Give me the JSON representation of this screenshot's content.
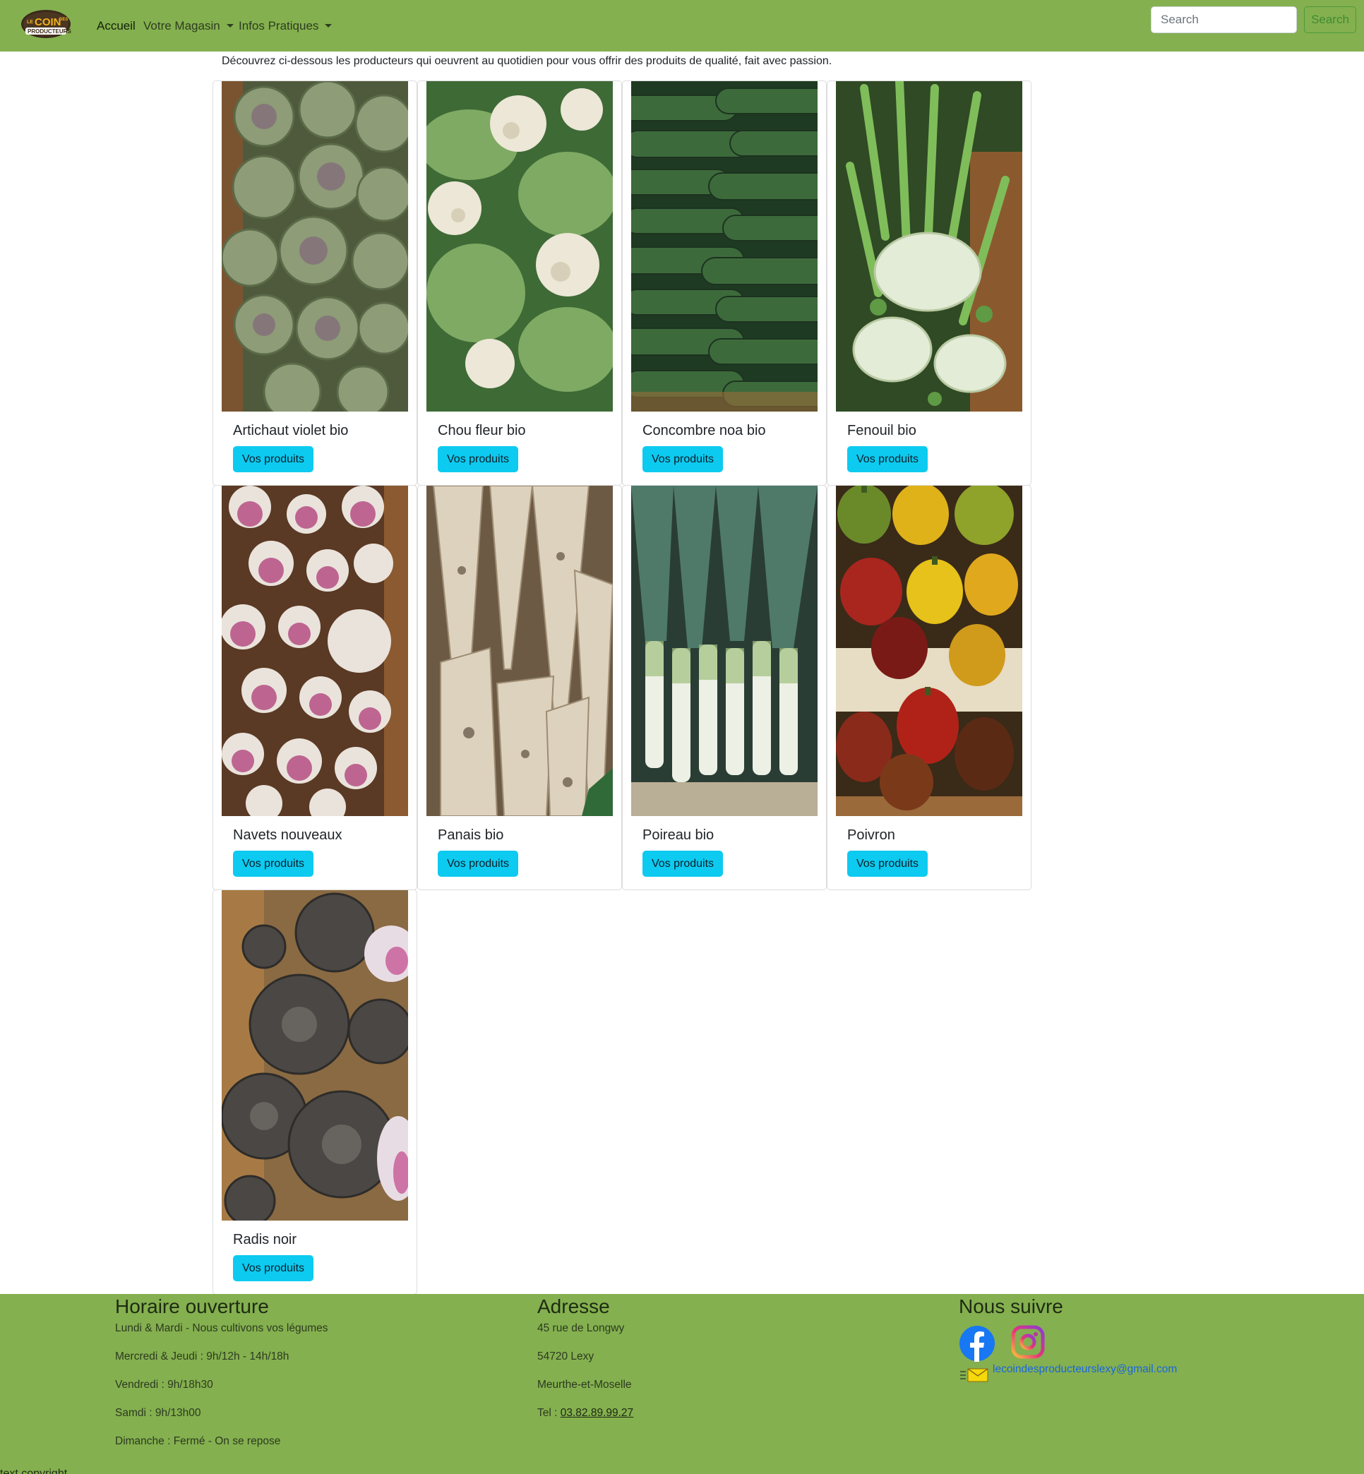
{
  "navbar": {
    "brand_name": "Le Coin des Producteurs",
    "brand_parts": {
      "top": "LE",
      "main": "COIN",
      "des": "DES",
      "bottom": "PRODUCTEURS"
    },
    "links": [
      {
        "label": "Accueil"
      },
      {
        "label": "Votre Magasin"
      },
      {
        "label": "Infos Pratiques"
      }
    ],
    "search": {
      "placeholder": "Search",
      "button_label": "Search"
    },
    "colors": {
      "background": "#84b04f",
      "search_button": "#3f8c31"
    }
  },
  "intro": "Découvrez ci-dessous les producteurs qui oeuvrent au quotidien pour vous offrir des produits de qualité, fait avec passion.",
  "products": [
    {
      "title": "Artichaut violet bio",
      "button_label": "Vos produits",
      "image": "artichoke-photo"
    },
    {
      "title": "Chou fleur bio",
      "button_label": "Vos produits",
      "image": "cauliflower-photo"
    },
    {
      "title": "Concombre noa bio",
      "button_label": "Vos produits",
      "image": "cucumber-photo"
    },
    {
      "title": "Fenouil bio",
      "button_label": "Vos produits",
      "image": "fennel-photo"
    },
    {
      "title": "Navets nouveaux",
      "button_label": "Vos produits",
      "image": "turnip-photo"
    },
    {
      "title": "Panais bio",
      "button_label": "Vos produits",
      "image": "parsnip-photo"
    },
    {
      "title": "Poireau bio",
      "button_label": "Vos produits",
      "image": "leek-photo"
    },
    {
      "title": "Poivron",
      "button_label": "Vos produits",
      "image": "pepper-photo"
    },
    {
      "title": "Radis noir",
      "button_label": "Vos produits",
      "image": "black-radish-photo"
    }
  ],
  "footer": {
    "hours": {
      "heading": "Horaire ouverture",
      "lines": [
        "Lundi & Mardi - Nous cultivons vos légumes",
        "Mercredi & Jeudi : 9h/12h - 14h/18h",
        "Vendredi : 9h/18h30",
        "Samdi : 9h/13h00",
        "Dimanche : Fermé - On se repose"
      ]
    },
    "address": {
      "heading": "Adresse",
      "lines": [
        "45 rue de Longwy",
        "54720 Lexy",
        "Meurthe-et-Moselle"
      ],
      "phone_label": "Tel : ",
      "phone": "03.82.89.99.27"
    },
    "social": {
      "heading": "Nous suivre",
      "icons": [
        "facebook-icon",
        "instagram-icon",
        "mail-icon"
      ],
      "email": "lecoindesproducteurslexy@gmail.com"
    },
    "copyright": "text copyright"
  },
  "colors": {
    "accent_button": "#0dcaf0",
    "footer_bg": "#84b04f",
    "link": "#1a66e0"
  }
}
